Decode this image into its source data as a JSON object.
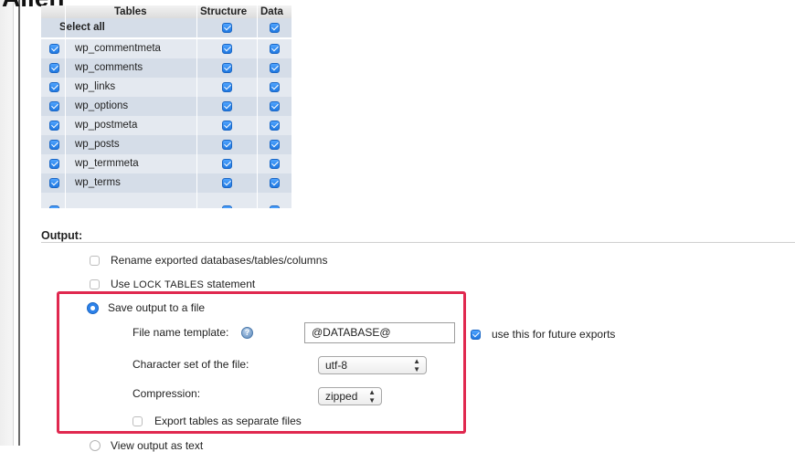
{
  "page": {
    "cropped_heading": "Allen"
  },
  "tables": {
    "headers": {
      "tables": "Tables",
      "structure": "Structure",
      "data": "Data"
    },
    "select_all": "Select all",
    "rows": [
      {
        "name": "wp_commentmeta",
        "checked": true,
        "structure": true,
        "data": true
      },
      {
        "name": "wp_comments",
        "checked": true,
        "structure": true,
        "data": true
      },
      {
        "name": "wp_links",
        "checked": true,
        "structure": true,
        "data": true
      },
      {
        "name": "wp_options",
        "checked": true,
        "structure": true,
        "data": true
      },
      {
        "name": "wp_postmeta",
        "checked": true,
        "structure": true,
        "data": true
      },
      {
        "name": "wp_posts",
        "checked": true,
        "structure": true,
        "data": true
      },
      {
        "name": "wp_termmeta",
        "checked": true,
        "structure": true,
        "data": true
      },
      {
        "name": "wp_terms",
        "checked": true,
        "structure": true,
        "data": true
      }
    ]
  },
  "output": {
    "label": "Output:",
    "rename_option": "Rename exported databases/tables/columns",
    "lock_prefix": "Use ",
    "lock_keyword": "LOCK TABLES",
    "lock_suffix": " statement",
    "save_to_file": "Save output to a file",
    "file_name_label": "File name template:",
    "file_name_value": "@DATABASE@",
    "future_exports": "use this for future exports",
    "charset_label": "Character set of the file:",
    "charset_value": "utf-8",
    "compression_label": "Compression:",
    "compression_value": "zipped",
    "separate_files": "Export tables as separate files",
    "view_as_text": "View output as text"
  },
  "colors": {
    "highlight": "#e0284f",
    "checkbox": "#2d82ea"
  }
}
